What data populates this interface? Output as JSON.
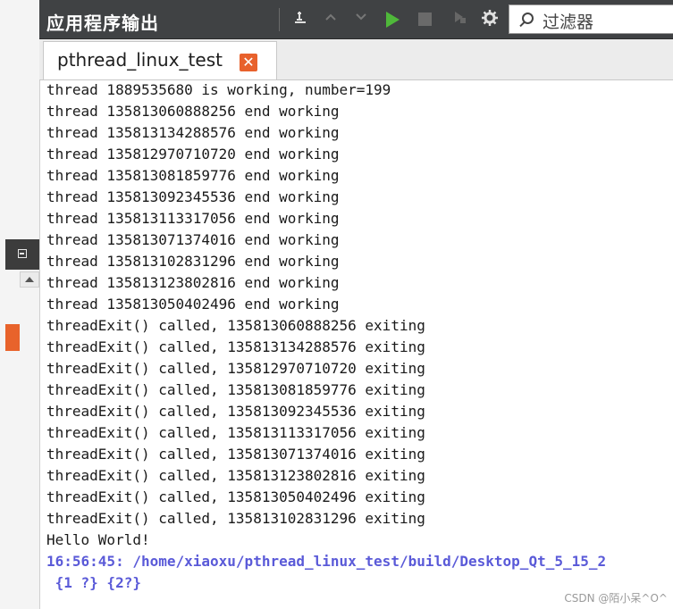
{
  "panel": {
    "title": "应用程序输出",
    "filter_placeholder": "过滤器"
  },
  "toolbar": {
    "icons": [
      "pin-icon",
      "arrow-up-icon",
      "arrow-down-icon",
      "run-icon",
      "stop-icon",
      "debug-run-icon",
      "gear-icon"
    ],
    "run_color": "#4fb83a"
  },
  "tab": {
    "label": "pthread_linux_test"
  },
  "output": {
    "lines": [
      "thread 1889535680 is working, number=199",
      "thread 135813060888256 end working",
      "thread 135813134288576 end working",
      "thread 135812970710720 end working",
      "thread 135813081859776 end working",
      "thread 135813092345536 end working",
      "thread 135813113317056 end working",
      "thread 135813071374016 end working",
      "thread 135813102831296 end working",
      "thread 135813123802816 end working",
      "thread 135813050402496 end working",
      "threadExit() called, 135813060888256 exiting",
      "threadExit() called, 135813134288576 exiting",
      "threadExit() called, 135812970710720 exiting",
      "threadExit() called, 135813081859776 exiting",
      "threadExit() called, 135813092345536 exiting",
      "threadExit() called, 135813113317056 exiting",
      "threadExit() called, 135813071374016 exiting",
      "threadExit() called, 135813123802816 exiting",
      "threadExit() called, 135813050402496 exiting",
      "threadExit() called, 135813102831296 exiting",
      "Hello World!"
    ],
    "status_line": "16:56:45: /home/xiaoxu/pthread_linux_test/build/Desktop_Qt_5_15_2",
    "status_args": " {1 ?} {2?}"
  },
  "watermark": "CSDN @陌小呆^O^"
}
